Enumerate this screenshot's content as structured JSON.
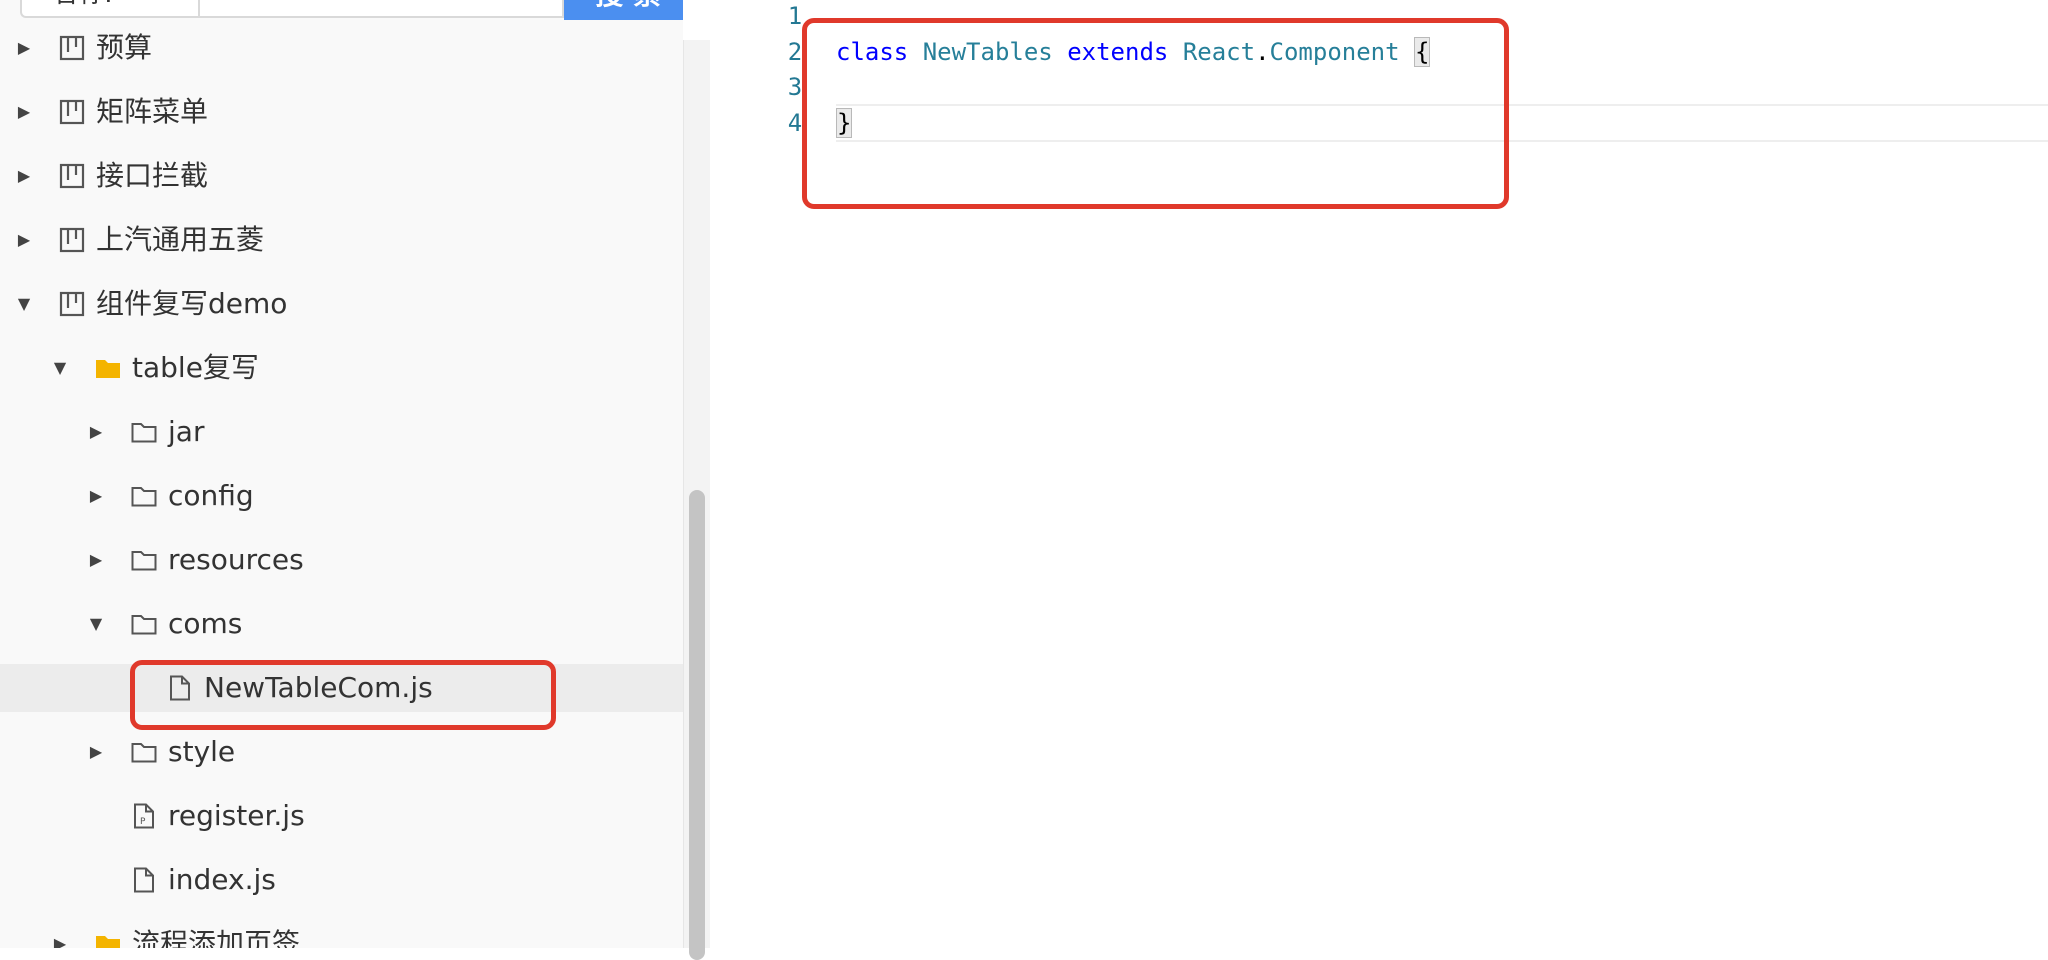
{
  "search": {
    "prefix": "名称:",
    "value": "",
    "button_label": "搜 索"
  },
  "tree": [
    {
      "label": "预算",
      "icon": "board-icon",
      "expanded": false,
      "depth": 0
    },
    {
      "label": "矩阵菜单",
      "icon": "board-icon",
      "expanded": false,
      "depth": 0
    },
    {
      "label": "接口拦截",
      "icon": "board-icon",
      "expanded": false,
      "depth": 0
    },
    {
      "label": "上汽通用五菱",
      "icon": "board-icon",
      "expanded": false,
      "depth": 0
    },
    {
      "label": "组件复写demo",
      "icon": "board-icon",
      "expanded": true,
      "depth": 0
    },
    {
      "label": "table复写",
      "icon": "folder-filled-icon",
      "expanded": true,
      "depth": 1
    },
    {
      "label": "jar",
      "icon": "folder-outline-icon",
      "expanded": false,
      "depth": 2
    },
    {
      "label": "config",
      "icon": "folder-outline-icon",
      "expanded": false,
      "depth": 2
    },
    {
      "label": "resources",
      "icon": "folder-outline-icon",
      "expanded": false,
      "depth": 2
    },
    {
      "label": "coms",
      "icon": "folder-outline-icon",
      "expanded": true,
      "depth": 2
    },
    {
      "label": "NewTableCom.js",
      "icon": "file-icon",
      "selected": true,
      "depth": 3
    },
    {
      "label": "style",
      "icon": "folder-outline-icon",
      "expanded": false,
      "depth": 2
    },
    {
      "label": "register.js",
      "icon": "file-p-icon",
      "depth": 2
    },
    {
      "label": "index.js",
      "icon": "file-icon",
      "depth": 2
    },
    {
      "label": "流程添加页签",
      "icon": "folder-filled-icon",
      "expanded": false,
      "depth": 1
    }
  ],
  "editor": {
    "line_numbers": [
      "1",
      "2",
      "3",
      "4"
    ],
    "line2": {
      "kw_class": "class",
      "name": "NewTables",
      "kw_extends": "extends",
      "base_obj": "React",
      "dot": ".",
      "base_cls": "Component",
      "open_brace": "{"
    },
    "line4": {
      "close_brace": "}"
    }
  },
  "colors": {
    "highlight": "#e0392b",
    "keyword": "#0000ff",
    "type": "#267f99",
    "primary_button": "#4b8ff0",
    "folder_filled": "#f4b400"
  }
}
